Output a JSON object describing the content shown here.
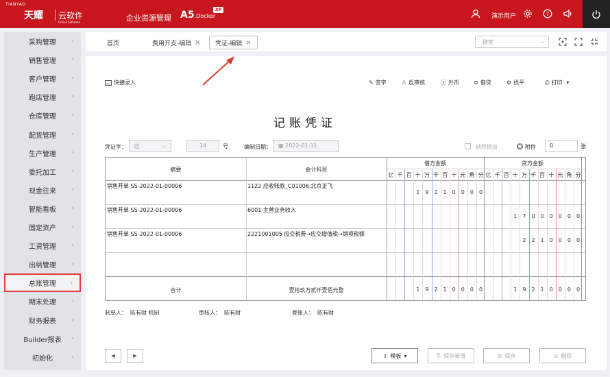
{
  "header": {
    "logo_small": "TIANYAO",
    "logo_main": "天耀",
    "logo_cloud": "云软件",
    "logo_en": "Online Software",
    "app_name": "企业资源管理",
    "product": "A5",
    "product_sub": ".Docker",
    "edition": "XP",
    "user": "演示用户"
  },
  "sidebar": {
    "items": [
      {
        "label": "采购管理"
      },
      {
        "label": "销售管理"
      },
      {
        "label": "客户管理"
      },
      {
        "label": "跑店管理"
      },
      {
        "label": "仓库管理"
      },
      {
        "label": "配货管理"
      },
      {
        "label": "生产管理"
      },
      {
        "label": "委托加工"
      },
      {
        "label": "现金往来"
      },
      {
        "label": "智能看板"
      },
      {
        "label": "固定资产"
      },
      {
        "label": "工资管理"
      },
      {
        "label": "出纳管理"
      },
      {
        "label": "总账管理"
      },
      {
        "label": "期末处理"
      },
      {
        "label": "财务报表"
      },
      {
        "label": "Builder报表"
      },
      {
        "label": "初始化"
      }
    ]
  },
  "tabs": {
    "home": "首页",
    "expense": "费用开支-编辑",
    "voucher": "凭证-编辑",
    "close": "×"
  },
  "search": {
    "placeholder": "搜索"
  },
  "toolbar": {
    "quick": "快捷录入",
    "sign": "签字",
    "unaudit": "反审核",
    "currency": "外币",
    "debit_credit": "借贷",
    "balance": "找平",
    "print": "打印"
  },
  "voucher": {
    "title": "记账凭证",
    "word_label": "凭证字：",
    "word_value": "记",
    "number_value": "14",
    "number_suffix": "号",
    "date_label": "编制日期：",
    "date_value": "2022-01-31",
    "carry_label": "结转损益",
    "attach_label": "附件",
    "attach_value": "0",
    "attach_unit": "张",
    "col_summary": "摘要",
    "col_account": "会计科目",
    "col_debit": "借方金额",
    "col_credit": "贷方金额",
    "units": [
      "亿",
      "千",
      "百",
      "十",
      "万",
      "千",
      "百",
      "十",
      "元",
      "角",
      "分"
    ],
    "rows": [
      {
        "summary": "销售开单 SS-2022-01-00006",
        "account": "1122 应收账款_C01006.北京正飞",
        "debit": [
          "",
          "",
          "",
          "1",
          "9",
          "2",
          "1",
          "0",
          "0",
          "0",
          "0"
        ],
        "credit": [
          "",
          "",
          "",
          "",
          "",
          "",
          "",
          "",
          "",
          "",
          ""
        ]
      },
      {
        "summary": "销售开单 SS-2022-01-00006",
        "account": "6001 主营业务收入",
        "debit": [
          "",
          "",
          "",
          "",
          "",
          "",
          "",
          "",
          "",
          "",
          ""
        ],
        "credit": [
          "",
          "",
          "",
          "1",
          "7",
          "0",
          "0",
          "0",
          "0",
          "0",
          "0"
        ]
      },
      {
        "summary": "销售开单 SS-2022-01-00006",
        "account": "2221001005 应交税费→应交增值税→销项税额",
        "debit": [
          "",
          "",
          "",
          "",
          "",
          "",
          "",
          "",
          "",
          "",
          ""
        ],
        "credit": [
          "",
          "",
          "",
          "",
          "2",
          "2",
          "1",
          "0",
          "0",
          "0",
          "0"
        ]
      }
    ],
    "total_label": "合计",
    "total_words": "壹拾玖万贰仟壹佰元整",
    "total_debit": [
      "",
      "",
      "",
      "1",
      "9",
      "2",
      "1",
      "0",
      "0",
      "0",
      "0"
    ],
    "total_credit": [
      "",
      "",
      "",
      "1",
      "9",
      "2",
      "1",
      "0",
      "0",
      "0",
      "0"
    ],
    "maker_label": "制单人：",
    "maker": "陈有财 机制",
    "auditor_label": "审核人：",
    "auditor": "陈有财",
    "poster_label": "登账人：",
    "poster": "陈有财"
  },
  "bottom": {
    "template": "模板",
    "save_new": "保存新增",
    "save": "保存",
    "delete": "删除"
  }
}
